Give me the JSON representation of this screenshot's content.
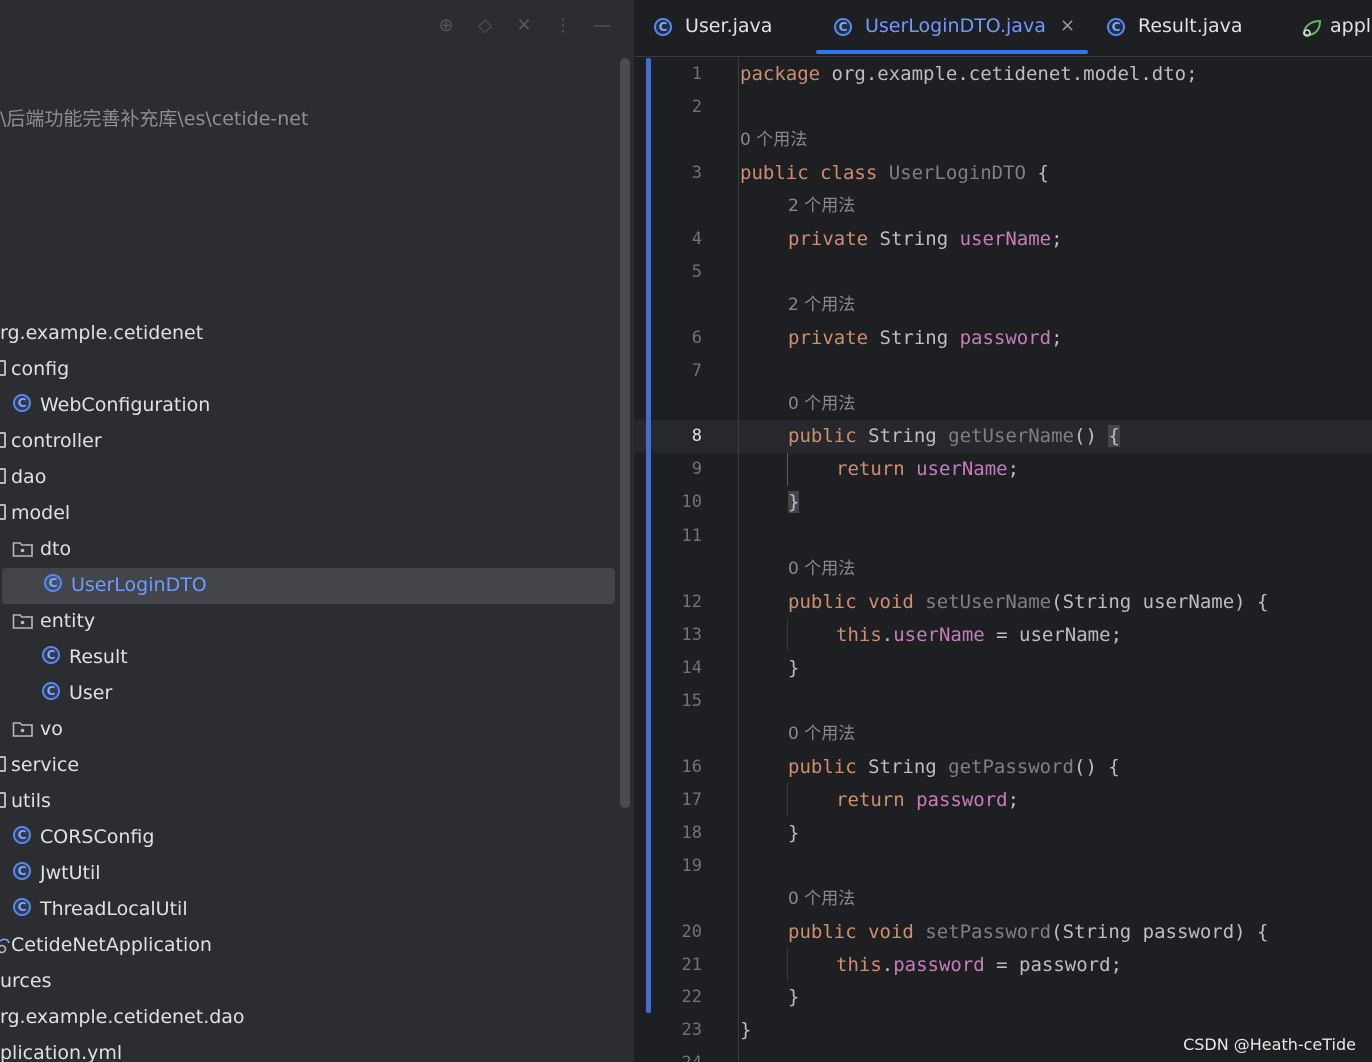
{
  "project_panel": {
    "path_text": "\\后端功能完善补充库\\es\\cetide-net",
    "tree": [
      {
        "label": "rg.example.cetidenet",
        "icon": "none"
      },
      {
        "label": "config",
        "icon": "folder-edge-icon"
      },
      {
        "label": "WebConfiguration",
        "icon": "class-icon"
      },
      {
        "label": "controller",
        "icon": "folder-edge-icon"
      },
      {
        "label": "dao",
        "icon": "folder-edge-icon"
      },
      {
        "label": "model",
        "icon": "folder-edge-icon"
      },
      {
        "label": "dto",
        "icon": "package-folder-icon"
      },
      {
        "label": "UserLoginDTO",
        "icon": "class-icon"
      },
      {
        "label": "entity",
        "icon": "package-folder-icon"
      },
      {
        "label": "Result",
        "icon": "class-icon"
      },
      {
        "label": "User",
        "icon": "class-icon"
      },
      {
        "label": "vo",
        "icon": "package-folder-icon"
      },
      {
        "label": "service",
        "icon": "folder-edge-icon"
      },
      {
        "label": "utils",
        "icon": "folder-edge-icon"
      },
      {
        "label": "CORSConfig",
        "icon": "class-icon"
      },
      {
        "label": "JwtUtil",
        "icon": "class-icon"
      },
      {
        "label": "ThreadLocalUtil",
        "icon": "class-icon"
      },
      {
        "label": "CetideNetApplication",
        "icon": "spring-app-icon"
      },
      {
        "label": "urces",
        "icon": "none"
      },
      {
        "label": "rg.example.cetidenet.dao",
        "icon": "none"
      },
      {
        "label": "plication.yml",
        "icon": "none"
      }
    ],
    "selected_item": "UserLoginDTO"
  },
  "tabs": [
    {
      "label": "User.java",
      "icon": "class-icon"
    },
    {
      "label": "UserLoginDTO.java",
      "icon": "class-icon",
      "active": true
    },
    {
      "label": "Result.java",
      "icon": "class-icon"
    },
    {
      "label": "appl",
      "icon": "spring-app-icon"
    }
  ],
  "editor": {
    "line_numbers": [
      "1",
      "2",
      "3",
      "4",
      "5",
      "6",
      "7",
      "8",
      "9",
      "10",
      "11",
      "12",
      "13",
      "14",
      "15",
      "16",
      "17",
      "18",
      "19",
      "20",
      "21",
      "22",
      "23",
      "24"
    ],
    "current_line": "8",
    "usage_hints": [
      "0 个用法",
      "2 个用法",
      "2 个用法",
      "0 个用法",
      "0 个用法",
      "0 个用法",
      "0 个用法"
    ],
    "code": {
      "l1_kw": "package",
      "l1_rest": " org.example.cetidenet.model.dto;",
      "l3_kw": "public class",
      "l3_name": " UserLoginDTO",
      "l3_rest": " {",
      "l4_kw": "private",
      "l4_type": " String ",
      "l4_field": "userName",
      "l4_end": ";",
      "l6_kw": "private",
      "l6_type": " String ",
      "l6_field": "password",
      "l6_end": ";",
      "l8_kw": "public",
      "l8_type": " String ",
      "l8_name": "getUserName",
      "l8_paren": "() ",
      "l8_brace": "{",
      "l9_kw": "return",
      "l9_field": "userName",
      "l9_end": ";",
      "l10": "}",
      "l12_kw": "public void",
      "l12_name": " setUserName",
      "l12_rest": "(String userName) {",
      "l13_kw": "this",
      "l13_dot": ".",
      "l13_field": "userName",
      "l13_rest": " = userName;",
      "l14": "}",
      "l16_kw": "public",
      "l16_type": " String ",
      "l16_name": "getPassword",
      "l16_rest": "() {",
      "l17_kw": "return",
      "l17_field": "password",
      "l17_end": ";",
      "l18": "}",
      "l20_kw": "public void",
      "l20_name": " setPassword",
      "l20_rest": "(String password) {",
      "l21_kw": "this",
      "l21_dot": ".",
      "l21_field": "password",
      "l21_rest": " = password;",
      "l22": "}",
      "l23": "}"
    }
  },
  "watermark": "CSDN @Heath-ceTide",
  "colors": {
    "accent": "#3574f0",
    "keyword": "#cf8e6d",
    "field": "#c77dbb",
    "selected_text": "#6f9bff"
  }
}
